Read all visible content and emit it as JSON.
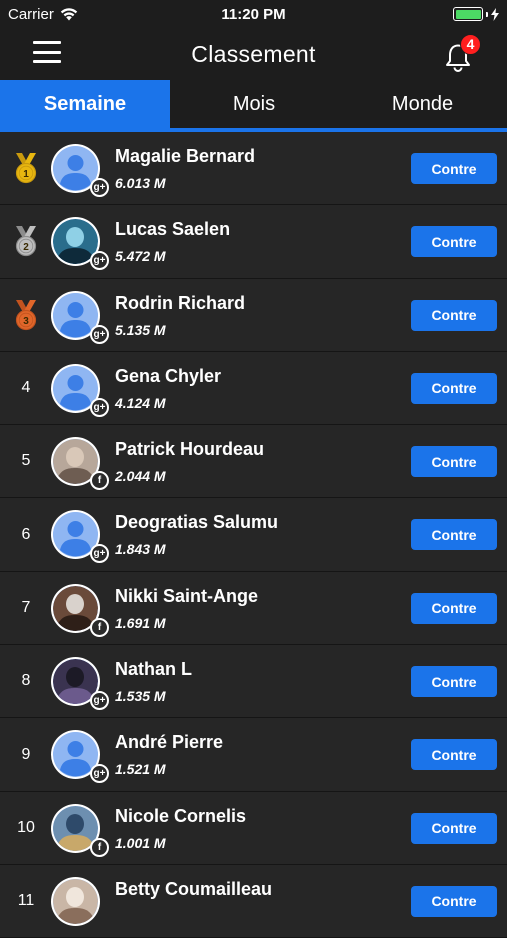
{
  "status_bar": {
    "carrier": "Carrier",
    "time": "11:20 PM",
    "battery_level": 1.0
  },
  "header": {
    "title": "Classement",
    "notification_count": "4"
  },
  "tabs": [
    {
      "label": "Semaine",
      "active": true
    },
    {
      "label": "Mois",
      "active": false
    },
    {
      "label": "Monde",
      "active": false
    }
  ],
  "colors": {
    "accent": "#1b74ea",
    "background": "#262626",
    "gold": "#e8b710",
    "silver": "#bfbfbf",
    "bronze": "#e0662a",
    "badge": "#ff1f1f"
  },
  "leaderboard": {
    "button_label": "Contre",
    "rows": [
      {
        "rank": "1",
        "medal": "gold",
        "name": "Magalie Bernard",
        "score": "6.013 M",
        "network": "google-plus-icon",
        "network_glyph": "g+",
        "avatar": "default-avatar-icon"
      },
      {
        "rank": "2",
        "medal": "silver",
        "name": "Lucas Saelen",
        "score": "5.472 M",
        "network": "google-plus-icon",
        "network_glyph": "g+",
        "avatar": "photo-cyclist"
      },
      {
        "rank": "3",
        "medal": "bronze",
        "name": "Rodrin Richard",
        "score": "5.135 M",
        "network": "google-plus-icon",
        "network_glyph": "g+",
        "avatar": "default-avatar-icon"
      },
      {
        "rank": "4",
        "medal": "",
        "name": "Gena Chyler",
        "score": "4.124 M",
        "network": "google-plus-icon",
        "network_glyph": "g+",
        "avatar": "default-avatar-icon"
      },
      {
        "rank": "5",
        "medal": "",
        "name": "Patrick Hourdeau",
        "score": "2.044 M",
        "network": "facebook-icon",
        "network_glyph": "f",
        "avatar": "photo-man-glasses"
      },
      {
        "rank": "6",
        "medal": "",
        "name": "Deogratias Salumu",
        "score": "1.843 M",
        "network": "google-plus-icon",
        "network_glyph": "g+",
        "avatar": "default-avatar-icon"
      },
      {
        "rank": "7",
        "medal": "",
        "name": "Nikki Saint-Ange",
        "score": "1.691 M",
        "network": "facebook-icon",
        "network_glyph": "f",
        "avatar": "photo-woman"
      },
      {
        "rank": "8",
        "medal": "",
        "name": "Nathan L",
        "score": "1.535 M",
        "network": "google-plus-icon",
        "network_glyph": "g+",
        "avatar": "photo-character"
      },
      {
        "rank": "9",
        "medal": "",
        "name": "André Pierre",
        "score": "1.521 M",
        "network": "google-plus-icon",
        "network_glyph": "g+",
        "avatar": "default-avatar-icon"
      },
      {
        "rank": "10",
        "medal": "",
        "name": "Nicole Cornelis",
        "score": "1.001 M",
        "network": "facebook-icon",
        "network_glyph": "f",
        "avatar": "photo-group"
      },
      {
        "rank": "11",
        "medal": "",
        "name": "Betty Coumailleau",
        "score": "",
        "network": "",
        "network_glyph": "",
        "avatar": "photo-cat"
      }
    ]
  }
}
